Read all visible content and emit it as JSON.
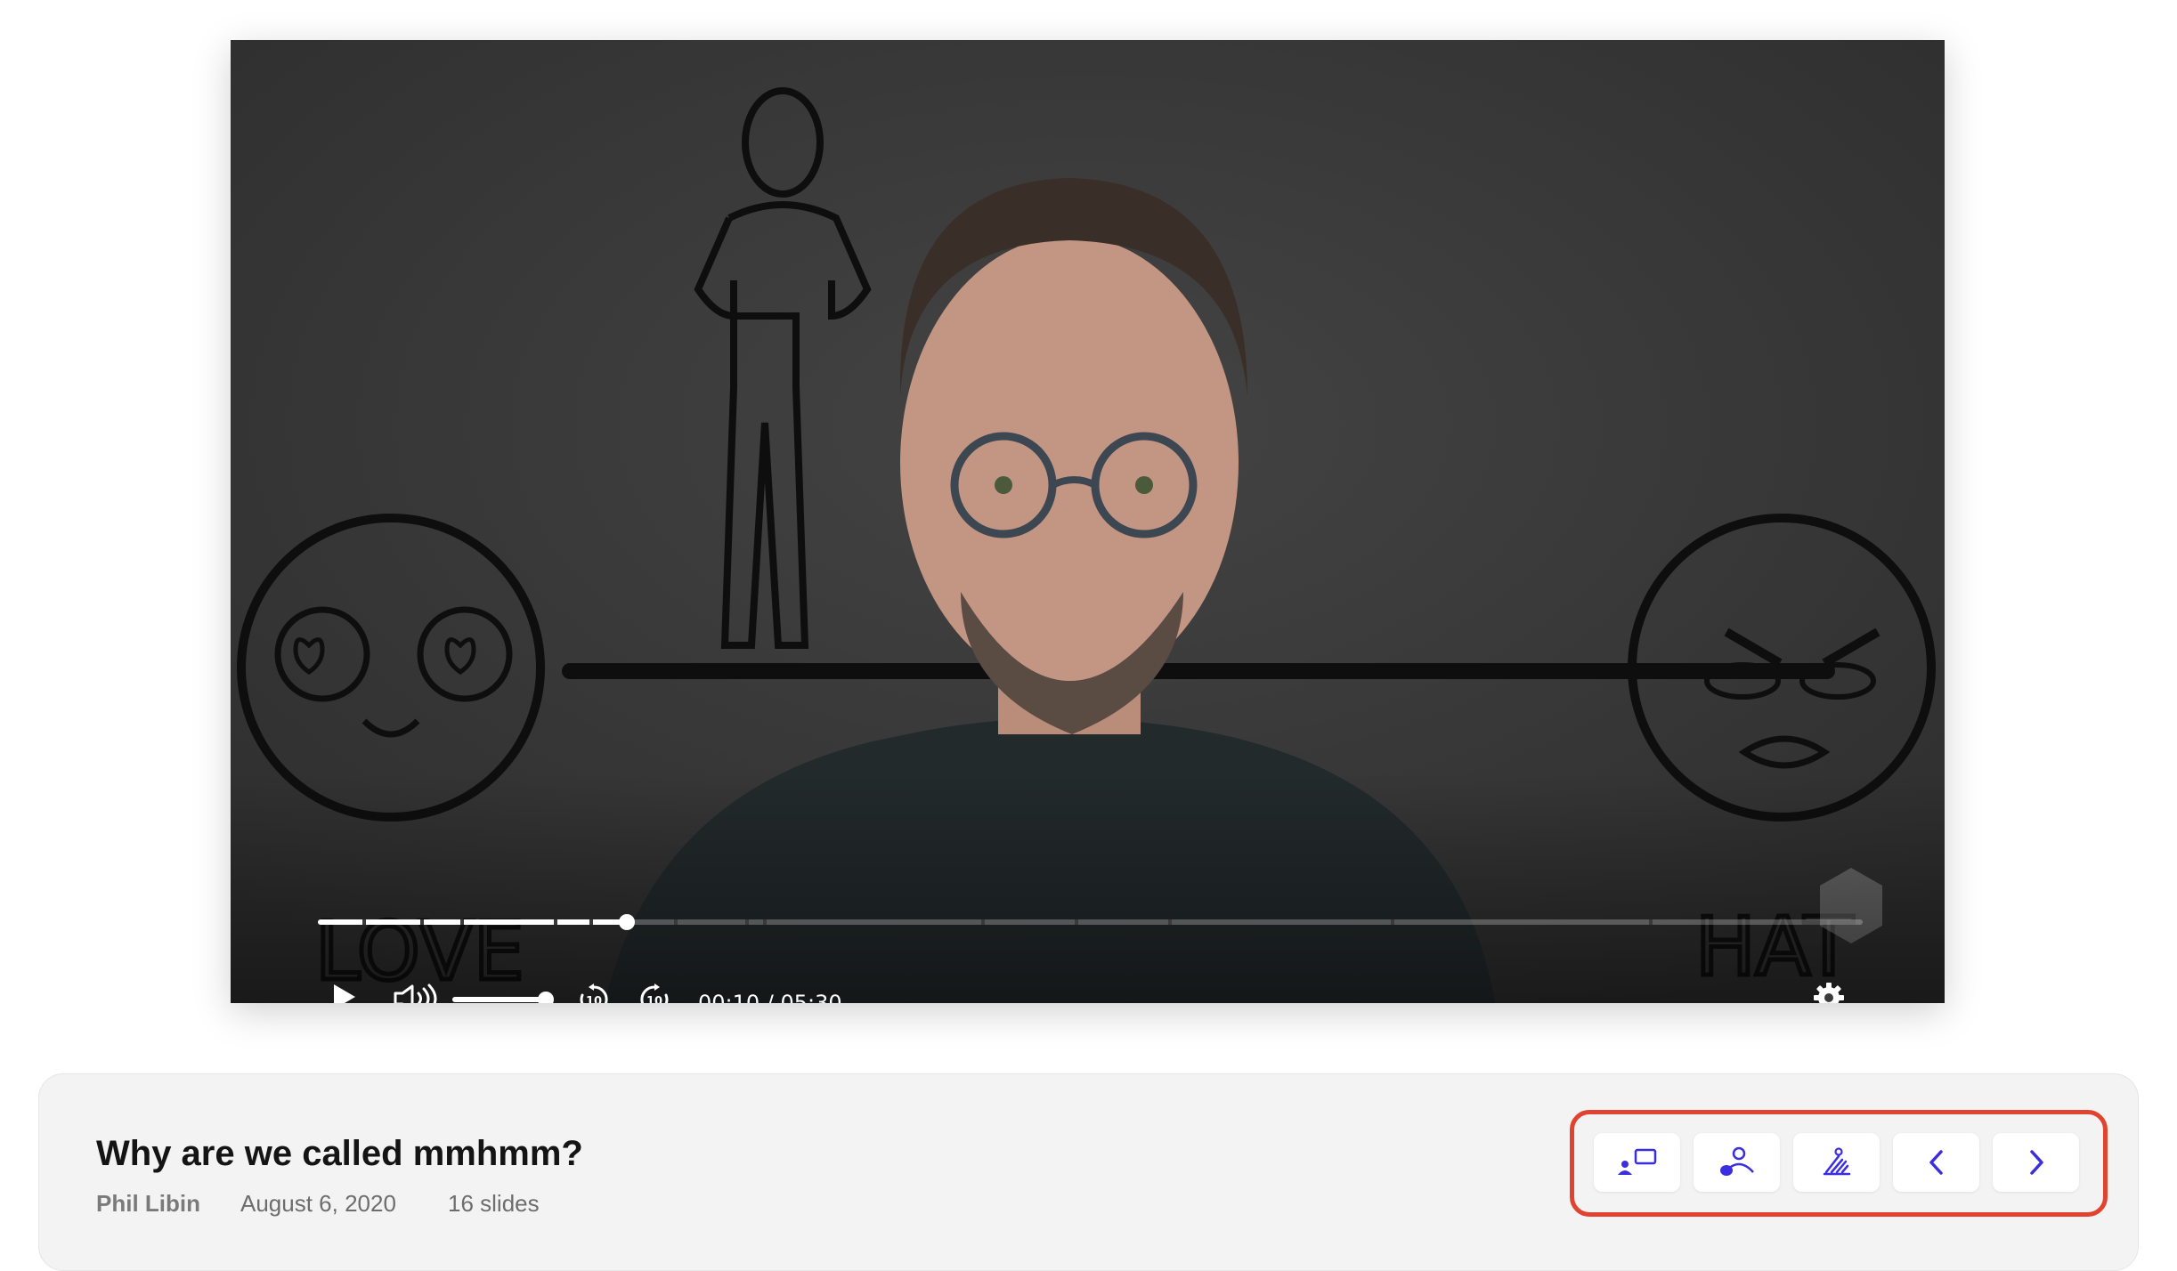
{
  "player": {
    "progress_fraction": 0.2,
    "volume_fraction": 1.0,
    "time_readout": "00:10 / 05:30",
    "controls": {
      "play_icon": "play-icon",
      "volume_icon": "volume-icon",
      "rewind_icon": "rewind-10-icon",
      "rewind_label": "10",
      "forward_icon": "forward-10-icon",
      "forward_label": "10",
      "settings_icon": "gear-icon"
    }
  },
  "video_info": {
    "title": "Why are we called mmhmm?",
    "author": "Phil Libin",
    "date": "August 6, 2020",
    "slides": "16 slides"
  },
  "actions": {
    "accent_color": "#3b2ee0",
    "highlight_color": "#e0432f",
    "buttons": [
      {
        "icon": "presenter-slide-icon"
      },
      {
        "icon": "presenter-only-icon"
      },
      {
        "icon": "slide-only-icon"
      },
      {
        "icon": "chevron-left-icon"
      },
      {
        "icon": "chevron-right-icon"
      }
    ]
  }
}
